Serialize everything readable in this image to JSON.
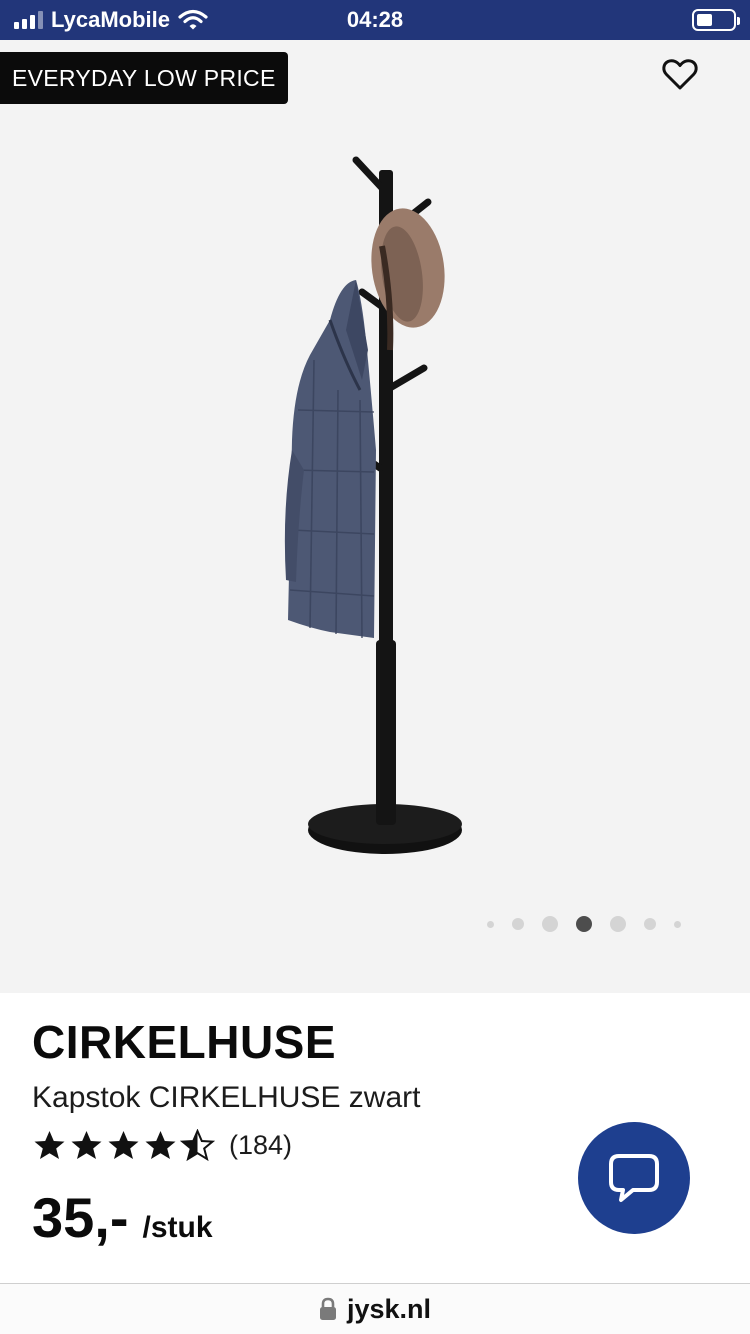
{
  "status_bar": {
    "carrier": "LycaMobile",
    "time": "04:28",
    "battery_level": 0.45
  },
  "product": {
    "badge": "EVERYDAY LOW PRICE",
    "brand": "CIRKELHUSE",
    "subtitle": "Kapstok CIRKELHUSE zwart",
    "rating": 4.5,
    "rating_count": "(184)",
    "price": "35,-",
    "unit": "/stuk"
  },
  "carousel": {
    "total": 7,
    "active_index": 3
  },
  "browser": {
    "url": "jysk.nl"
  },
  "colors": {
    "status_bar_bg": "#22367a",
    "chat_button": "#1e3f8f",
    "badge_bg": "#0b0b0b",
    "image_bg": "#f3f3f3"
  },
  "icons": {
    "favorite": "heart-outline-icon",
    "chat": "chat-bubble-icon",
    "lock": "lock-icon"
  }
}
